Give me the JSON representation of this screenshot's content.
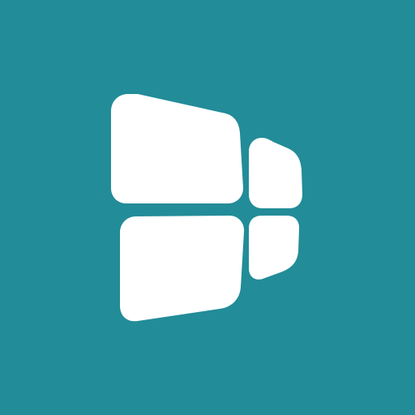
{
  "icon": {
    "name": "windowed-panels-logo",
    "background_color": "#228C98",
    "foreground_color": "#FFFFFF"
  }
}
